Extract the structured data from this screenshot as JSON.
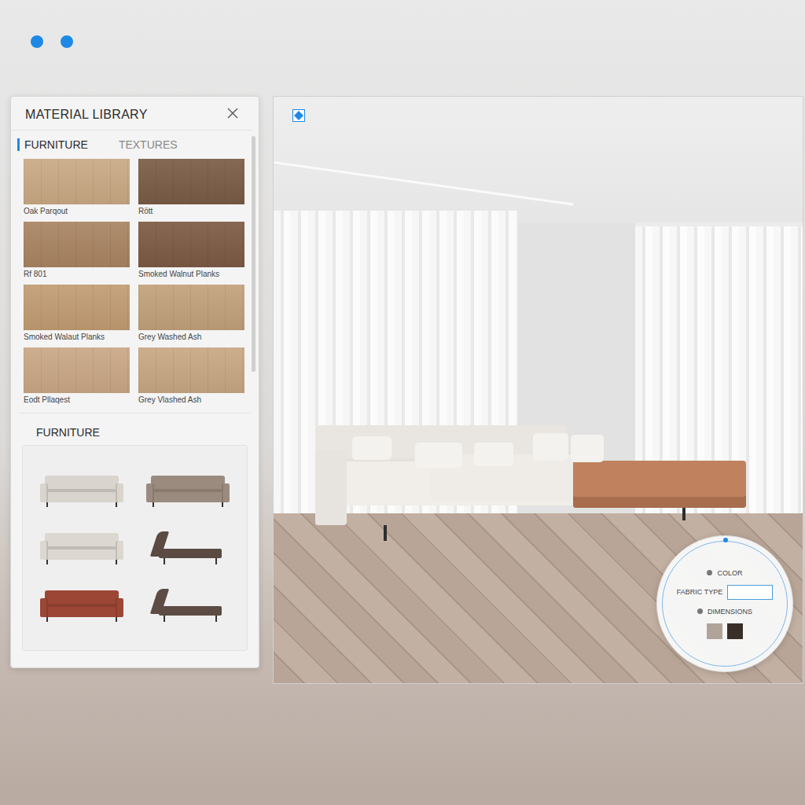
{
  "panel": {
    "title": "MATERIAL LIBRARY",
    "tabs": [
      {
        "label": "FURNITURE",
        "selected": true
      },
      {
        "label": "TEXTURES",
        "selected": false
      }
    ],
    "swatches": [
      {
        "label": "Oak Parqout",
        "color": "#c9a984"
      },
      {
        "label": "Rött",
        "color": "#7a5c46"
      },
      {
        "label": "Rf 801",
        "color": "#a88462"
      },
      {
        "label": "Smoked Walnut Planks",
        "color": "#7d5a44"
      },
      {
        "label": "Smoked Walaut Planks",
        "color": "#c19c72"
      },
      {
        "label": "Grey Washed Ash",
        "color": "#c2a17b"
      },
      {
        "label": "Eodt Pllaqest",
        "color": "#c9a785"
      },
      {
        "label": "Grey Vlashed Ash",
        "color": "#c8a783"
      }
    ],
    "furniture": {
      "title": "FURNITURE",
      "items": [
        {
          "kind": "sofa",
          "color": "#d9d4cd"
        },
        {
          "kind": "sofa",
          "color": "#9b8b7f"
        },
        {
          "kind": "sofa",
          "color": "#dcd7d0"
        },
        {
          "kind": "chaise",
          "color": "#5a4a42"
        },
        {
          "kind": "sofa",
          "color": "#9c4636"
        },
        {
          "kind": "chaise",
          "color": "#5c4c44"
        }
      ]
    }
  },
  "properties": {
    "items": [
      {
        "label": "COLOR",
        "kind": "dot"
      },
      {
        "label": "FABRIC TYPE",
        "kind": "field"
      },
      {
        "label": "DIMENSIONS",
        "kind": "dot"
      }
    ],
    "swatches": [
      {
        "color": "#b0a49a"
      },
      {
        "color": "#3a2e28"
      }
    ]
  }
}
